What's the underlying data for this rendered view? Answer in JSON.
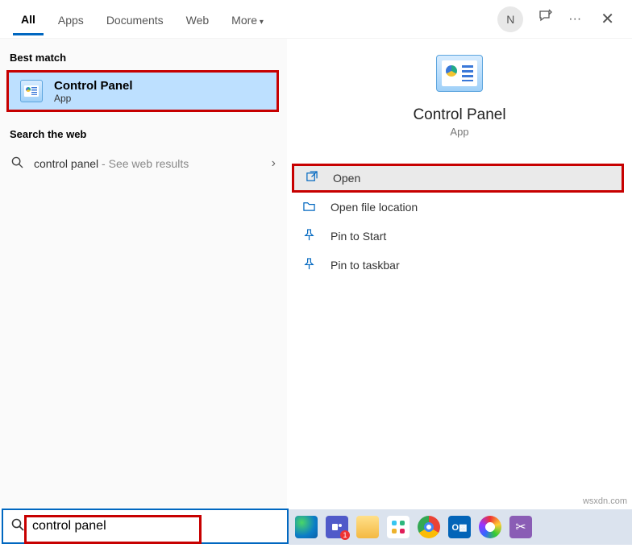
{
  "tabs": {
    "all": "All",
    "apps": "Apps",
    "documents": "Documents",
    "web": "Web",
    "more": "More"
  },
  "avatar_letter": "N",
  "ellipsis": "···",
  "section_best": "Best match",
  "section_web": "Search the web",
  "best": {
    "title": "Control Panel",
    "subtitle": "App"
  },
  "web_result": {
    "query": "control panel",
    "suffix": " - See web results"
  },
  "preview": {
    "title": "Control Panel",
    "subtitle": "App"
  },
  "actions": {
    "open": "Open",
    "file_loc": "Open file location",
    "pin_start": "Pin to Start",
    "pin_taskbar": "Pin to taskbar"
  },
  "search_value": "control panel",
  "outlook_label": "O▩",
  "watermark": "wsxdn.com"
}
